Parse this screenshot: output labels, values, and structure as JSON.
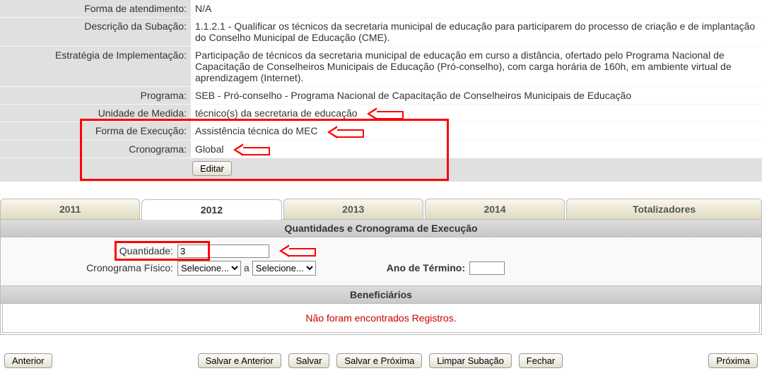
{
  "form": {
    "forma_atendimento": {
      "label": "Forma de atendimento:",
      "value": "N/A"
    },
    "descricao_subacao": {
      "label": "Descrição da Subação:",
      "value": "1.1.2.1 - Qualificar os técnicos da secretaria municipal de educação para participarem do processo de criação e de implantação do Conselho Municipal de Educação (CME)."
    },
    "estrategia_implementacao": {
      "label": "Estratégia de Implementação:",
      "value": "Participação de técnicos da secretaria municipal de educação em curso a distância, ofertado pelo Programa Nacional de Capacitação de Conselheiros Municipais de Educação (Pró-conselho), com carga horária de 160h, em ambiente virtual de aprendizagem (Internet)."
    },
    "programa": {
      "label": "Programa:",
      "value": "SEB - Pró-conselho - Programa Nacional de Capacitação de Conselheiros Municipais de Educação"
    },
    "unidade_medida": {
      "label": "Unidade de Medida:",
      "value": "técnico(s) da secretaria de educação"
    },
    "forma_execucao": {
      "label": "Forma de Execução:",
      "value": "Assistência técnica do MEC"
    },
    "cronograma": {
      "label": "Cronograma:",
      "value": "Global"
    },
    "editar_btn": "Editar"
  },
  "tabs": {
    "t2011": "2011",
    "t2012": "2012",
    "t2013": "2013",
    "t2014": "2014",
    "totalizadores": "Totalizadores"
  },
  "section": {
    "quantidades_header": "Quantidades e Cronograma de Execução",
    "quantidade_label": "Quantidade:",
    "quantidade_value": "3",
    "cronograma_fisico_label": "Cronograma Físico:",
    "selecione": "Selecione...",
    "a": "a",
    "ano_termino_label": "Ano de Término:",
    "ano_termino_value": "",
    "beneficiarios_header": "Beneficiários",
    "no_records": "Não foram encontrados Registros."
  },
  "buttons": {
    "anterior": "Anterior",
    "salvar_anterior": "Salvar e Anterior",
    "salvar": "Salvar",
    "salvar_proxima": "Salvar e Próxima",
    "limpar_subacao": "Limpar Subação",
    "fechar": "Fechar",
    "proxima": "Próxima"
  }
}
